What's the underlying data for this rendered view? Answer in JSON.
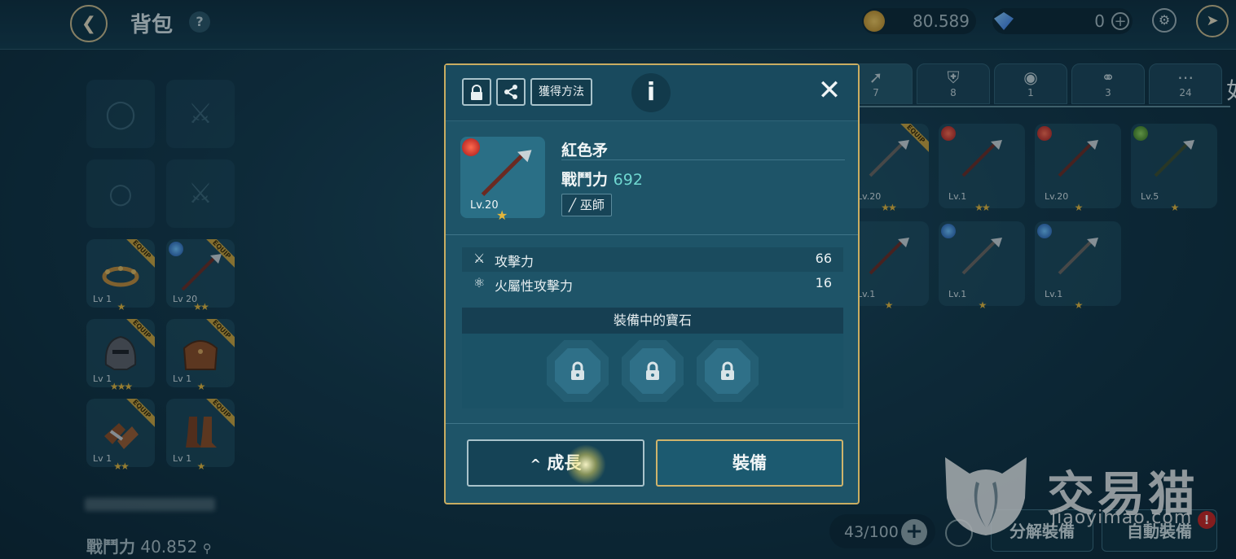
{
  "header": {
    "title": "背包",
    "help": "?",
    "gold": "80.589",
    "gems": "0",
    "plus": "+",
    "edge_char": "如"
  },
  "equipment": {
    "slots": [
      {
        "lv": "Lv 1",
        "stars": "★",
        "equip": "EQUIP"
      },
      {
        "lv": "Lv 20",
        "stars": "★★",
        "equip": "EQUIP"
      },
      {
        "lv": "Lv 1",
        "stars": "★★★",
        "equip": "EQUIP"
      },
      {
        "lv": "Lv 1",
        "stars": "★",
        "equip": "EQUIP"
      },
      {
        "lv": "Lv 1",
        "stars": "★★",
        "equip": "EQUIP"
      },
      {
        "lv": "Lv 1",
        "stars": "★",
        "equip": "EQUIP"
      }
    ],
    "power_label": "戰鬥力",
    "power_value": "40.852"
  },
  "inventory": {
    "tabs": [
      {
        "icon": "spear-icon",
        "count": "7"
      },
      {
        "icon": "shield-icon",
        "count": "8"
      },
      {
        "icon": "necklace-icon",
        "count": "1"
      },
      {
        "icon": "ring-icon",
        "count": "3"
      },
      {
        "icon": "more-icon",
        "count": "24"
      }
    ],
    "items": [
      {
        "lv": "Lv.20",
        "stars": "★★",
        "element": "none",
        "equip": "EQUIP"
      },
      {
        "lv": "Lv.1",
        "stars": "★★",
        "element": "fire"
      },
      {
        "lv": "Lv.20",
        "stars": "★",
        "element": "fire"
      },
      {
        "lv": "Lv.5",
        "stars": "★",
        "element": "earth"
      },
      {
        "lv": "Lv.1",
        "stars": "★",
        "element": "none"
      },
      {
        "lv": "Lv.1",
        "stars": "★",
        "element": "water"
      },
      {
        "lv": "Lv.1",
        "stars": "★",
        "element": "water"
      }
    ],
    "capacity": "43/100",
    "dismantle_label": "分解裝備",
    "auto_equip_label": "自動裝備",
    "alert": "!"
  },
  "modal": {
    "acquire_label": "獲得方法",
    "info": "i",
    "close": "✕",
    "item_name": "紅色矛",
    "item_level": "Lv.20",
    "item_star": "★",
    "power_label": "戰鬥力",
    "power_value": "692",
    "class_label": "巫師",
    "stats": [
      {
        "label": "攻擊力",
        "value": "66"
      },
      {
        "label": "火屬性攻擊力",
        "value": "16"
      }
    ],
    "gems_title": "裝備中的寶石",
    "grow_label": "成長",
    "equip_label": "裝備"
  },
  "watermark": {
    "brand": "交易猫",
    "domain": "jiaoyimao.com"
  },
  "colors": {
    "gold_border": "#c9ad62",
    "power_value": "#6fd7d0",
    "star": "#e3b63c"
  }
}
